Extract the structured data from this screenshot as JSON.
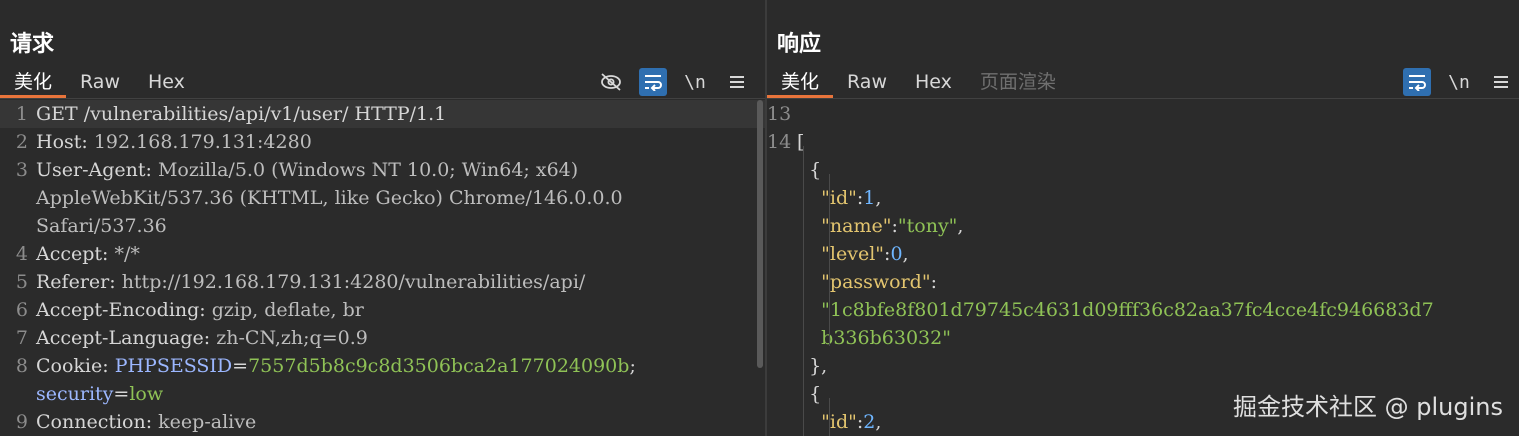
{
  "request": {
    "title": "请求",
    "tabs": [
      "美化",
      "Raw",
      "Hex"
    ],
    "active_tab": 0,
    "tools": {
      "hide_icon": "eye-slash-icon",
      "wrap_icon": "wrap-lines-icon",
      "newline_label": "\\n",
      "menu_icon": "hamburger-menu-icon"
    },
    "lines": [
      {
        "n": "1",
        "parts": [
          {
            "t": "GET /vulnerabilities/api/v1/user/ HTTP/1.1",
            "c": "key"
          }
        ]
      },
      {
        "n": "2",
        "parts": [
          {
            "t": "Host: ",
            "c": "key"
          },
          {
            "t": "192.168.179.131:4280",
            "c": "val"
          }
        ]
      },
      {
        "n": "3",
        "parts": [
          {
            "t": "User-Agent: ",
            "c": "key"
          },
          {
            "t": "Mozilla/5.0 (Windows NT 10.0; Win64; x64)",
            "c": "val"
          }
        ]
      },
      {
        "n": "",
        "parts": [
          {
            "t": "AppleWebKit/537.36 (KHTML, like Gecko) Chrome/146.0.0.0",
            "c": "val"
          }
        ]
      },
      {
        "n": "",
        "parts": [
          {
            "t": "Safari/537.36",
            "c": "val"
          }
        ]
      },
      {
        "n": "4",
        "parts": [
          {
            "t": "Accept: ",
            "c": "key"
          },
          {
            "t": "*/*",
            "c": "val"
          }
        ]
      },
      {
        "n": "5",
        "parts": [
          {
            "t": "Referer: ",
            "c": "key"
          },
          {
            "t": "http://192.168.179.131:4280/vulnerabilities/api/",
            "c": "val"
          }
        ]
      },
      {
        "n": "6",
        "parts": [
          {
            "t": "Accept-Encoding: ",
            "c": "key"
          },
          {
            "t": "gzip, deflate, br",
            "c": "val"
          }
        ]
      },
      {
        "n": "7",
        "parts": [
          {
            "t": "Accept-Language: ",
            "c": "key"
          },
          {
            "t": "zh-CN,zh;q=0.9",
            "c": "val"
          }
        ]
      },
      {
        "n": "8",
        "parts": [
          {
            "t": "Cookie: ",
            "c": "key"
          },
          {
            "t": "PHPSESSID",
            "c": "ck"
          },
          {
            "t": "=",
            "c": "key"
          },
          {
            "t": "7557d5b8c9c8d3506bca2a177024090b",
            "c": "cv"
          },
          {
            "t": ";",
            "c": "key"
          }
        ]
      },
      {
        "n": "",
        "parts": [
          {
            "t": "security",
            "c": "ck"
          },
          {
            "t": "=",
            "c": "key"
          },
          {
            "t": "low",
            "c": "cv"
          }
        ]
      },
      {
        "n": "9",
        "parts": [
          {
            "t": "Connection: ",
            "c": "key"
          },
          {
            "t": "keep-alive",
            "c": "val"
          }
        ]
      }
    ]
  },
  "response": {
    "title": "响应",
    "tabs": [
      "美化",
      "Raw",
      "Hex",
      "页面渲染"
    ],
    "active_tab": 0,
    "tools": {
      "wrap_icon": "wrap-lines-icon",
      "newline_label": "\\n",
      "menu_icon": "hamburger-menu-icon"
    },
    "lines": [
      {
        "n": "13",
        "parts": []
      },
      {
        "n": "14",
        "parts": [
          {
            "t": "[",
            "c": "punct"
          }
        ]
      },
      {
        "n": "",
        "parts": [
          {
            "t": "  {",
            "c": "punct"
          }
        ]
      },
      {
        "n": "",
        "parts": [
          {
            "t": "    ",
            "c": "punct"
          },
          {
            "t": "\"id\"",
            "c": "str"
          },
          {
            "t": ":",
            "c": "punct"
          },
          {
            "t": "1",
            "c": "num"
          },
          {
            "t": ",",
            "c": "punct"
          }
        ]
      },
      {
        "n": "",
        "parts": [
          {
            "t": "    ",
            "c": "punct"
          },
          {
            "t": "\"name\"",
            "c": "str"
          },
          {
            "t": ":",
            "c": "punct"
          },
          {
            "t": "\"tony\"",
            "c": "jv"
          },
          {
            "t": ",",
            "c": "punct"
          }
        ]
      },
      {
        "n": "",
        "parts": [
          {
            "t": "    ",
            "c": "punct"
          },
          {
            "t": "\"level\"",
            "c": "str"
          },
          {
            "t": ":",
            "c": "punct"
          },
          {
            "t": "0",
            "c": "num"
          },
          {
            "t": ",",
            "c": "punct"
          }
        ]
      },
      {
        "n": "",
        "parts": [
          {
            "t": "    ",
            "c": "punct"
          },
          {
            "t": "\"password\"",
            "c": "str"
          },
          {
            "t": ":",
            "c": "punct"
          }
        ]
      },
      {
        "n": "",
        "parts": [
          {
            "t": "    ",
            "c": "punct"
          },
          {
            "t": "\"1c8bfe8f801d79745c4631d09fff36c82aa37fc4cce4fc946683d7",
            "c": "jv"
          }
        ]
      },
      {
        "n": "",
        "parts": [
          {
            "t": "    ",
            "c": "punct"
          },
          {
            "t": "b336b63032\"",
            "c": "jv"
          }
        ]
      },
      {
        "n": "",
        "parts": [
          {
            "t": "  },",
            "c": "punct"
          }
        ]
      },
      {
        "n": "",
        "parts": [
          {
            "t": "  {",
            "c": "punct"
          }
        ]
      },
      {
        "n": "",
        "parts": [
          {
            "t": "    ",
            "c": "punct"
          },
          {
            "t": "\"id\"",
            "c": "str"
          },
          {
            "t": ":",
            "c": "punct"
          },
          {
            "t": "2",
            "c": "num"
          },
          {
            "t": ",",
            "c": "punct"
          }
        ]
      }
    ]
  },
  "layout_switch": {
    "icons": [
      "split-columns-icon",
      "split-rows-icon",
      "single-panel-icon"
    ],
    "active": 0
  },
  "watermark": "掘金技术社区 @ plugins",
  "colors": {
    "accent": "#e8743b",
    "active_tool": "#2f6fb0",
    "background": "#2b2b2b"
  }
}
